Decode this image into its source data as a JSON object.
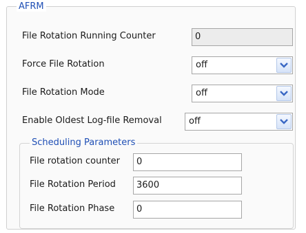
{
  "afrm": {
    "legend": "AFRM",
    "running_counter": {
      "label": "File Rotation Running Counter",
      "value": "0"
    },
    "force_rotation": {
      "label": "Force File Rotation",
      "value": "off"
    },
    "rotation_mode": {
      "label": "File Rotation Mode",
      "value": "off"
    },
    "oldest_removal": {
      "label": "Enable Oldest Log-file Removal",
      "value": "off"
    }
  },
  "scheduling": {
    "legend": "Scheduling Parameters",
    "counter": {
      "label": "File rotation counter",
      "value": "0"
    },
    "period": {
      "label": "File Rotation Period",
      "value": "3600"
    },
    "phase": {
      "label": "File Rotation Phase",
      "value": "0"
    }
  },
  "icons": {
    "dropdown": "chevron-down-icon"
  },
  "colors": {
    "legend_text": "#1f4fb5",
    "readonly_bg": "#ececec",
    "chevron": "#3a68c4"
  }
}
